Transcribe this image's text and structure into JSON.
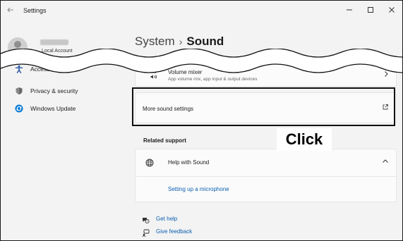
{
  "window": {
    "title": "Settings",
    "controls": [
      "minimize",
      "maximize",
      "close"
    ]
  },
  "sidebar": {
    "profile": {
      "account_type": "Local Account"
    },
    "items": [
      {
        "label": "Accessibility",
        "icon": "accessibility-icon"
      },
      {
        "label": "Privacy & security",
        "icon": "shield-icon"
      },
      {
        "label": "Windows Update",
        "icon": "windows-update-icon"
      }
    ]
  },
  "main": {
    "breadcrumb": {
      "parent": "System",
      "separator": "›",
      "current": "Sound"
    },
    "volume_mixer": {
      "title": "Volume mixer",
      "subtitle": "App volume mix, app input & output devices"
    },
    "more_sound_settings": {
      "title": "More sound settings"
    },
    "related_support": {
      "heading": "Related support",
      "help": {
        "title": "Help with Sound"
      },
      "link": "Setting up a microphone"
    },
    "footer": {
      "get_help": "Get help",
      "give_feedback": "Give feedback"
    }
  },
  "annotation": {
    "label": "Click"
  },
  "colors": {
    "accent": "#0a5fb0",
    "highlight_border": "#111111",
    "update_blue": "#0078d4"
  }
}
